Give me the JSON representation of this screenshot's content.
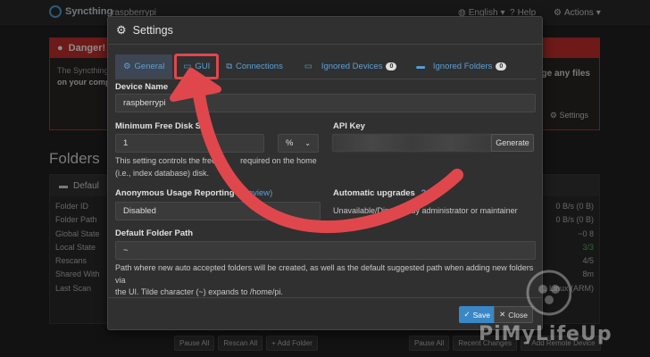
{
  "navbar": {
    "brand": "Syncthing",
    "hostname": "raspberrypi",
    "language": "English",
    "help": "Help",
    "actions": "Actions"
  },
  "danger": {
    "title": "Danger!",
    "line1": "The Syncthing",
    "line2": "on your comp",
    "right_text": "nge any files",
    "settings_link": "Settings"
  },
  "folders": {
    "title": "Folders",
    "folder_name": "Defaul",
    "rows": [
      "Folder ID",
      "Folder Path",
      "Global State",
      "Local State",
      "Rescans",
      "Shared With",
      "Last Scan"
    ],
    "values": [
      "0 B/s (0 B)",
      "0 B/s (0 B)",
      "~0 8",
      "3/3",
      "4/5",
      "8m",
      "1.1, Linux (ARM)"
    ],
    "bottom_left": [
      "Pause All",
      "Rescan All",
      "+ Add Folder"
    ],
    "bottom_right": [
      "Pause All",
      "Recent Changes",
      "+ Add Remote Device"
    ]
  },
  "modal": {
    "title": "Settings",
    "tabs": [
      {
        "label": "General",
        "icon": "gear-icon"
      },
      {
        "label": "GUI",
        "icon": "monitor-icon"
      },
      {
        "label": "Connections",
        "icon": "network-icon"
      },
      {
        "label": "Ignored Devices",
        "icon": "laptop-icon",
        "badge": "0"
      },
      {
        "label": "Ignored Folders",
        "icon": "folder-icon",
        "badge": "0"
      }
    ],
    "device_name_label": "Device Name",
    "device_name_value": "raspberrypi",
    "min_free_disk_label": "Minimum Free Disk Sp",
    "min_free_disk_value": "1",
    "min_free_disk_unit": "%",
    "min_free_disk_help": "This setting controls the free sp required on the home (i.e., index database) disk.",
    "min_free_disk_help_line1": "This setting controls the free sp      required on the home",
    "min_free_disk_help_line2": "(i.e., index database) disk.",
    "api_key_label": "API Key",
    "generate_button": "Generate",
    "usage_reporting_label": "Anonymous Usage Reporting",
    "usage_reporting_link": "(Preview)",
    "usage_reporting_value": "Disabled",
    "auto_upgrades_label": "Automatic upgrades",
    "auto_upgrades_text": "Unavailable/Dis       d by administrator or maintainer",
    "default_folder_label": "Default Folder Path",
    "default_folder_value": "~",
    "default_folder_help_line1": "Path where new auto accepted folders will be created, as well as the default suggested path when adding new folders via",
    "default_folder_help_line2": "the UI. Tilde character (~) expands to /home/pi.",
    "save_button": "Save",
    "close_button": "Close"
  },
  "watermark": "PiMyLifeUp",
  "colors": {
    "accent": "#3a87c6",
    "link": "#5aa0d6",
    "danger": "#c9302c",
    "annotation": "#e0474c"
  }
}
